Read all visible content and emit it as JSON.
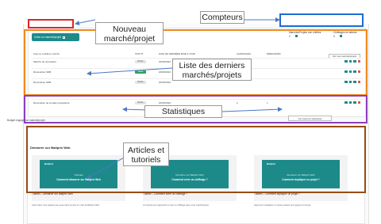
{
  "app": {
    "new_project_button": "Créer un marché/projet",
    "counters": [
      {
        "label": "Marchés/Projets non chiffrés",
        "value": "2"
      },
      {
        "label": "Chiffrages en attente",
        "value": "0"
      }
    ],
    "see_all_button": "Voir mes marchés/projets",
    "table": {
      "headers": [
        "Créé ou modifié le marché",
        "STATUT",
        "DATE DE DERNIÈRE MISE À JOUR",
        "CHIFFRAGES",
        "DÉBOURSÉS"
      ],
      "rows": [
        {
          "name": "Marché de rénovation",
          "status": "Étude",
          "status_type": "neutral",
          "date": "20/05/2022",
          "chiffrages": "",
          "debourses": ""
        },
        {
          "name": "Rénovation SDB",
          "status": "Validé",
          "status_type": "done",
          "date": "20/05/2022",
          "chiffrages": "",
          "debourses": ""
        },
        {
          "name": "Rénovation SDB",
          "status": "Étude",
          "status_type": "neutral",
          "date": "20/05/2022",
          "chiffrages": "",
          "debourses": ""
        },
        {
          "name": "Rénovation de la salle polyvalente",
          "status": "Étude",
          "status_type": "neutral",
          "date": "20/05/2022",
          "chiffrages": "2",
          "debourses": "1"
        }
      ]
    },
    "budget_label": "Budget engagé par marché/projet",
    "stats_button": "Voir toutes les statistiques",
    "start_title": "Démarrer sur Batiprix Web",
    "tutorials": [
      {
        "logo": "Batiprix",
        "subtitle": "Tutoriels",
        "title": "Comment démarrer sur Batiprix Web",
        "caption": "Tutoriel – Démarrer sur Batiprix Web",
        "text": "Cette vidéo vous guidera pas à pas dans la prise en main de Batiprix Web."
      },
      {
        "logo": "Batiprix",
        "subtitle": "Démarrer sur Batiprix Web",
        "title": "Comment créer un chiffrage ?",
        "caption": "Tutoriel – Comment créer un chiffrage ?",
        "text": "Un tutoriel pour apprendre à créer un chiffrage dans votre marché/projet."
      },
      {
        "logo": "Batiprix",
        "subtitle": "Démarrer sur Batiprix Web",
        "title": "Comment dupliquer un projet ?",
        "caption": "Tutoriel – Comment dupliquer un projet ?",
        "text": "Apprenez à dupliquer un projet existant pour gagner du temps."
      }
    ]
  },
  "annotations": {
    "new_project": "Nouveau marché/projet",
    "counters": "Compteurs",
    "latest": "Liste des derniers marchés/projets",
    "stats": "Statistiques",
    "articles": "Articles et tutoriels"
  },
  "colors": {
    "red": "#e0242a",
    "blue": "#1c6cd4",
    "orange": "#f08a1c",
    "purple": "#8c3fbf",
    "brown": "#9a4a14",
    "teal": "#1d8a8a"
  }
}
